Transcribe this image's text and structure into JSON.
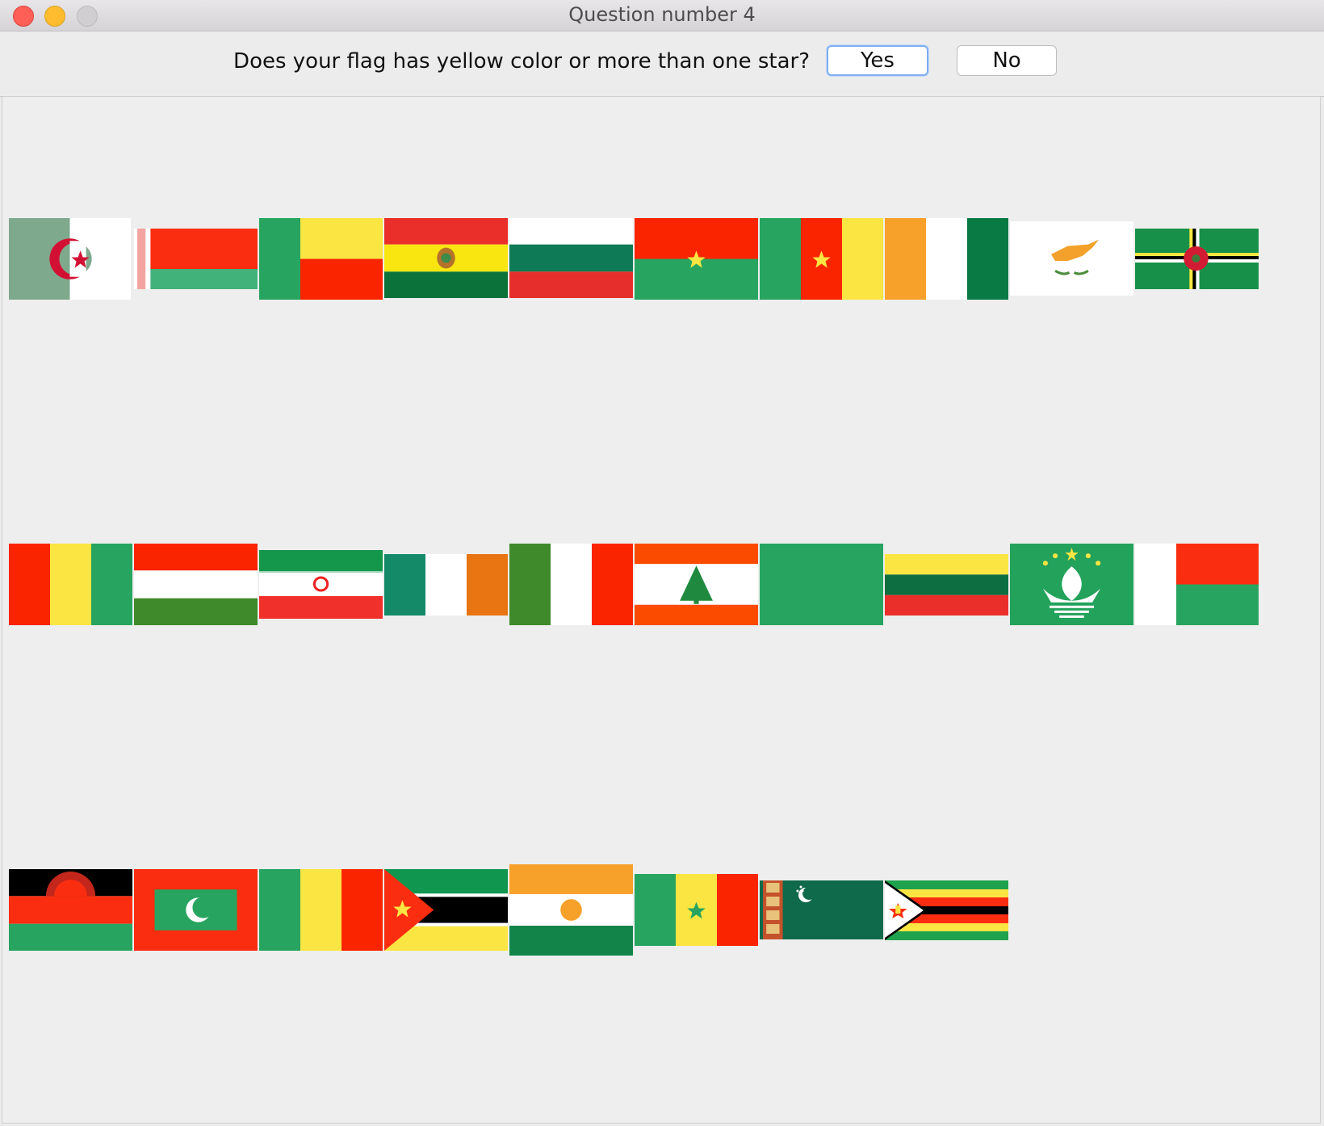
{
  "window": {
    "title": "Question number 4"
  },
  "toolbar": {
    "question": "Does your flag has yellow color or more than one star?",
    "yes_label": "Yes",
    "no_label": "No"
  },
  "flags": [
    "algeria-flag",
    "belarus-flag",
    "benin-flag",
    "bolivia-flag",
    "bulgaria-flag",
    "burkina-faso-flag",
    "cameroon-flag",
    "cote-divoire-flag",
    "cyprus-flag",
    "dominica-flag",
    "guinea-flag",
    "hungary-flag",
    "iran-flag",
    "ireland-flag",
    "italy-flag",
    "lebanon-flag",
    "libya-flag",
    "lithuania-flag",
    "macau-flag",
    "madagascar-flag",
    "malawi-flag",
    "maldives-flag",
    "mali-flag",
    "mozambique-flag",
    "niger-flag",
    "senegal-flag",
    "turkmenistan-flag",
    "zimbabwe-flag"
  ]
}
